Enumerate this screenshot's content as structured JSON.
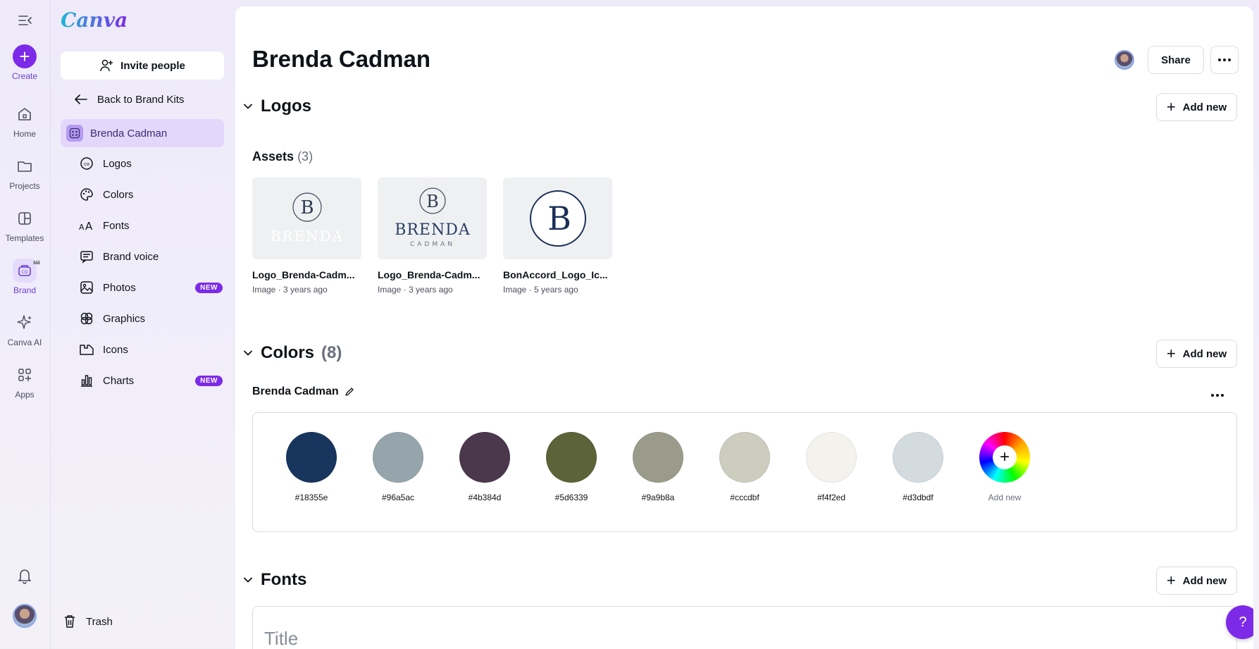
{
  "app": {
    "logo": "Canva"
  },
  "rail": {
    "create": "Create",
    "home": "Home",
    "projects": "Projects",
    "templates": "Templates",
    "brand": "Brand",
    "canva_ai": "Canva AI",
    "apps": "Apps"
  },
  "sidebar": {
    "invite": "Invite people",
    "back": "Back to Brand Kits",
    "kit_name": "Brenda Cadman",
    "items": [
      {
        "label": "Logos",
        "icon": "logo-icon"
      },
      {
        "label": "Colors",
        "icon": "palette-icon"
      },
      {
        "label": "Fonts",
        "icon": "font-icon"
      },
      {
        "label": "Brand voice",
        "icon": "message-icon"
      },
      {
        "label": "Photos",
        "icon": "image-icon",
        "badge": "NEW"
      },
      {
        "label": "Graphics",
        "icon": "shapes-icon"
      },
      {
        "label": "Icons",
        "icon": "icons-icon"
      },
      {
        "label": "Charts",
        "icon": "chart-icon",
        "badge": "NEW"
      }
    ],
    "trash": "Trash"
  },
  "header": {
    "title": "Brenda Cadman",
    "share": "Share"
  },
  "logos": {
    "title": "Logos",
    "add_new": "Add new",
    "assets_label": "Assets",
    "assets_count": "(3)",
    "assets": [
      {
        "name": "Logo_Brenda-Cadm...",
        "meta": "Image · 3 years ago",
        "wordmark": "BRENDA",
        "initial": "B"
      },
      {
        "name": "Logo_Brenda-Cadm...",
        "meta": "Image · 3 years ago",
        "wordmark": "BRENDA",
        "submark": "CADMAN",
        "initial": "B"
      },
      {
        "name": "BonAccord_Logo_Ic...",
        "meta": "Image · 5 years ago",
        "initial": "B"
      }
    ]
  },
  "colors": {
    "title": "Colors",
    "count": "(8)",
    "add_new": "Add new",
    "palette_name": "Brenda Cadman",
    "swatches": [
      "#18355e",
      "#96a5ac",
      "#4b384d",
      "#5d6339",
      "#9a9b8a",
      "#cccdbf",
      "#f4f2ed",
      "#d3dbdf"
    ],
    "add_label": "Add new"
  },
  "fonts": {
    "title": "Fonts",
    "add_new": "Add new",
    "title_placeholder": "Title"
  },
  "help": "?"
}
